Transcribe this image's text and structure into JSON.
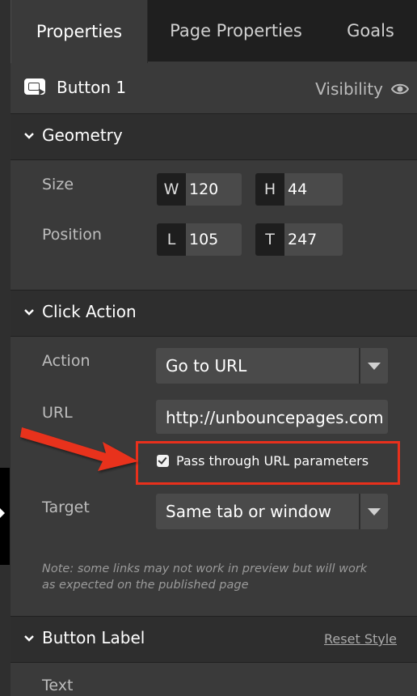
{
  "tabs": [
    {
      "label": "Properties",
      "active": true
    },
    {
      "label": "Page Properties",
      "active": false
    },
    {
      "label": "Goals",
      "active": false
    }
  ],
  "element": {
    "name": "Button 1",
    "icon": "button-element-icon",
    "visibility_label": "Visibility",
    "visibility_icon": "eye-icon"
  },
  "geometry": {
    "title": "Geometry",
    "size_label": "Size",
    "position_label": "Position",
    "width": {
      "prefix": "W",
      "value": "120"
    },
    "height": {
      "prefix": "H",
      "value": "44"
    },
    "left": {
      "prefix": "L",
      "value": "105"
    },
    "top": {
      "prefix": "T",
      "value": "247"
    }
  },
  "click_action": {
    "title": "Click Action",
    "action_label": "Action",
    "action_value": "Go to URL",
    "url_label": "URL",
    "url_value": "http://unbouncepages.com",
    "pass_through_label": "Pass through URL parameters",
    "pass_through_checked": true,
    "target_label": "Target",
    "target_value": "Same tab or window",
    "note": "Note: some links may not work in preview but will work as expected on the published page"
  },
  "button_label": {
    "title": "Button Label",
    "reset_style": "Reset Style",
    "text_label": "Text"
  },
  "colors": {
    "panel_bg": "#3a3a3a",
    "header_bg": "#2e2e2e",
    "tabbar_bg": "#1f1f1f",
    "annotation_red": "#e8301c"
  }
}
